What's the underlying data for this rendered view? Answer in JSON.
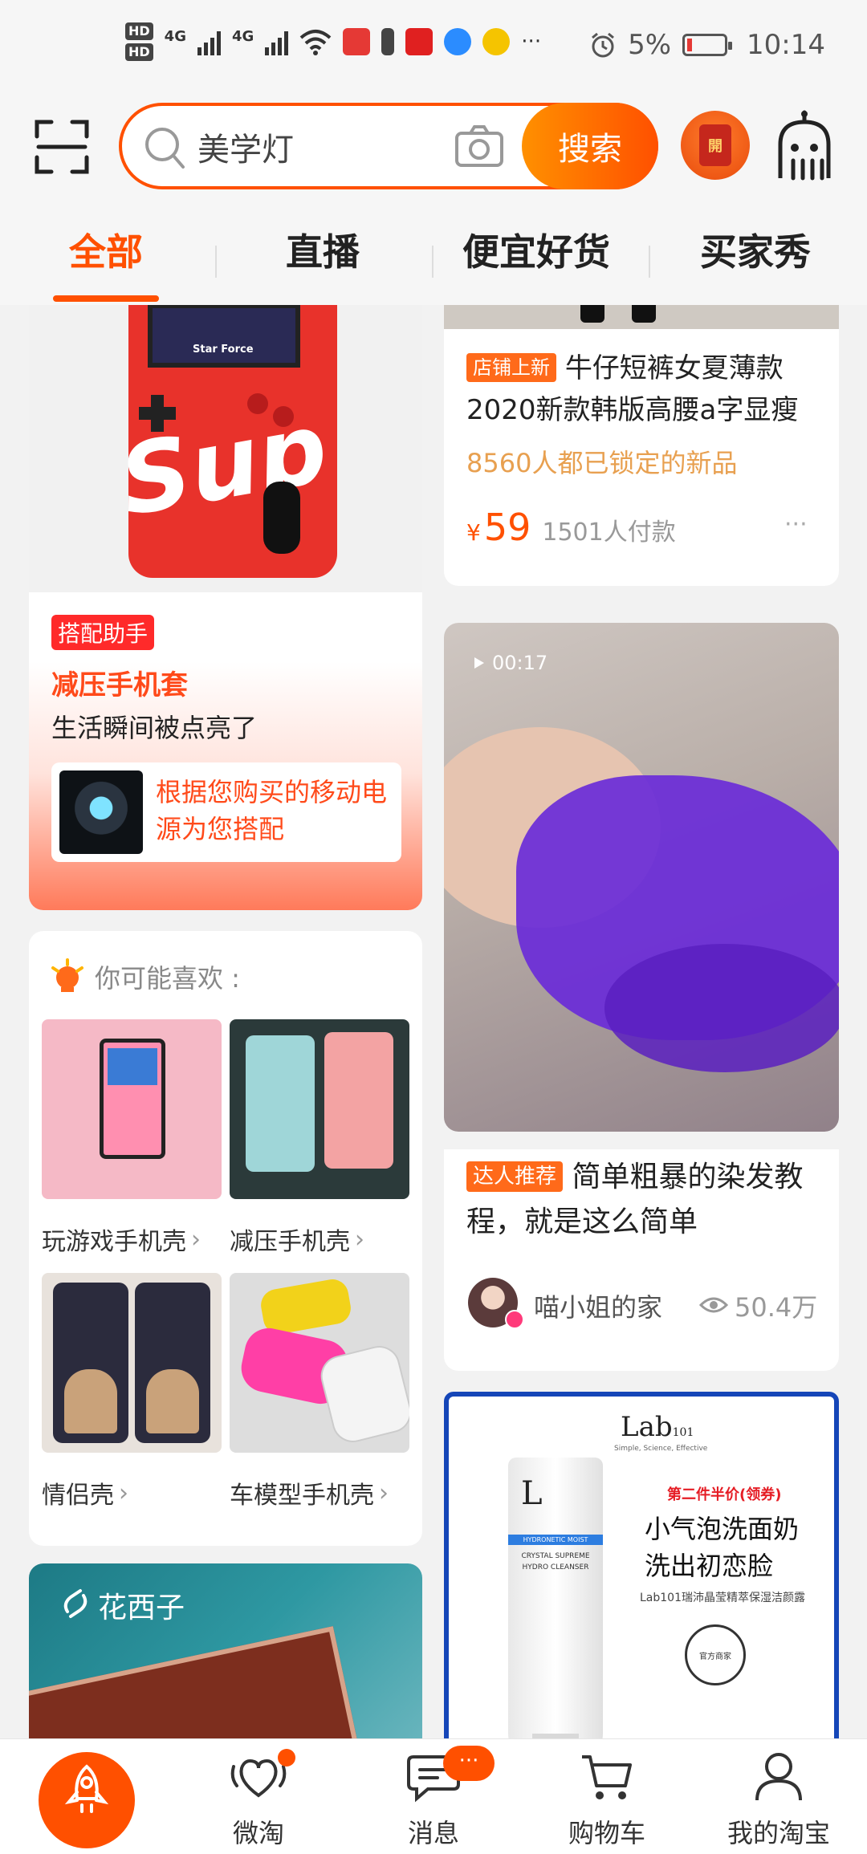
{
  "status_bar": {
    "hd1": "HD",
    "hd2": "HD",
    "net1": "4G",
    "net2": "4G",
    "more": "···",
    "battery_pct": "5%",
    "time": "10:14"
  },
  "header": {
    "search_placeholder": "美学灯",
    "search_button": "搜索",
    "redpack_label": "開"
  },
  "tabs": [
    {
      "label": "全部",
      "active": true
    },
    {
      "label": "直播",
      "active": false
    },
    {
      "label": "便宜好货",
      "active": false
    },
    {
      "label": "买家秀",
      "active": false
    }
  ],
  "left_col": {
    "phone_card": {
      "image_text": "Sup",
      "screen_caption": "Star Force",
      "badge": "搭配助手",
      "title": "减压手机套",
      "subtitle": "生活瞬间被点亮了",
      "suggest_text": "根据您购买的移动电源为您搭配"
    },
    "recommend": {
      "heading": "你可能喜欢 :",
      "items": [
        {
          "label": "玩游戏手机壳"
        },
        {
          "label": "减压手机壳"
        },
        {
          "label": "情侣壳"
        },
        {
          "label": "车模型手机壳"
        }
      ]
    },
    "brand_card": {
      "brand": "花西子"
    }
  },
  "right_col": {
    "product": {
      "tag": "店铺上新",
      "title": "牛仔短裤女夏薄款2020新款韩版高腰a字显瘦",
      "highlight": "8560人都已锁定的新品",
      "price_symbol": "¥",
      "price": "59",
      "sales": "1501人付款",
      "more": "···"
    },
    "video": {
      "duration": "00:17",
      "tag": "达人推荐",
      "title": "简单粗暴的染发教程，就是这么简单",
      "author": "喵小姐的家",
      "views": "50.4万"
    },
    "ad": {
      "brand": "Lab",
      "brand_sub": "101",
      "tagline": "Simple, Science, Effective",
      "promo": "第二件半价(领券)",
      "headline1": "小气泡洗面奶",
      "headline2": "洗出初恋脸",
      "desc": "Lab101瑞沛晶莹精萃保湿洁颜露",
      "tube_line1": "HYDRONETIC MOIST",
      "tube_line2": "CRYSTAL SUPREME",
      "tube_line3": "HYDRO CLEANSER",
      "seal_text": "官方商家"
    }
  },
  "bottom_nav": [
    {
      "label": "",
      "active": true
    },
    {
      "label": "微淘"
    },
    {
      "label": "消息",
      "badge": "···"
    },
    {
      "label": "购物车"
    },
    {
      "label": "我的淘宝"
    }
  ],
  "colors": {
    "accent": "#ff5000",
    "accent_light": "#ff9000",
    "highlight_text": "#e8a050",
    "video_purple": "#6a2bd8"
  }
}
